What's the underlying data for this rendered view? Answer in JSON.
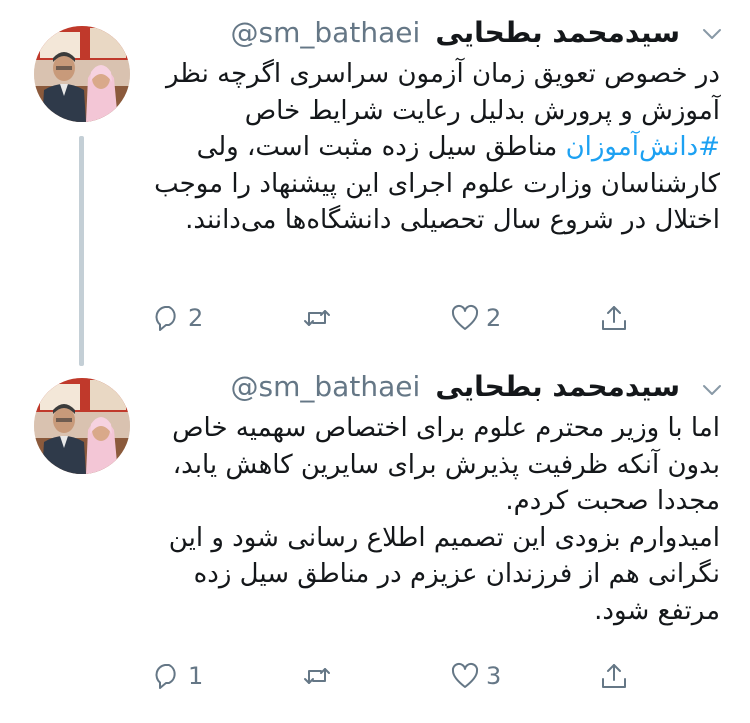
{
  "tweets": [
    {
      "author_name": "سیدمحمد بطحایی",
      "handle": "@sm_bathaei",
      "text_before_hashtag": "در خصوص تعویق زمان آزمون سراسری اگرچه نظر آموزش و پرورش بدلیل رعایت شرایط خاص ",
      "hashtag": "#دانش‌آموزان",
      "text_after_hashtag": " مناطق سیل زده مثبت است، ولی کارشناسان وزارت علوم اجرای این پیشنهاد را موجب اختلال در شروع سال تحصیلی دانشگاه‌ها می‌دانند.",
      "reply_count": "2",
      "retweet_count": "",
      "like_count": "2",
      "icons": {
        "reply": "reply-icon",
        "retweet": "retweet-icon",
        "like": "heart-icon",
        "share": "share-icon",
        "menu": "chevron-down-icon"
      }
    },
    {
      "author_name": "سیدمحمد بطحایی",
      "handle": "@sm_bathaei",
      "paragraph_1": "اما با وزیر محترم علوم برای اختصاص سهمیه خاص بدون آنکه ظرفیت پذیرش برای سایرین کاهش یابد، مجددا صحبت کردم.",
      "paragraph_2": "امیدوارم بزودی این تصمیم اطلاع رسانی شود و این نگرانی هم از فرزندان عزیزم در مناطق سیل زده مرتفع شود.",
      "reply_count": "1",
      "retweet_count": "",
      "like_count": "3",
      "icons": {
        "reply": "reply-icon",
        "retweet": "retweet-icon",
        "like": "heart-icon",
        "share": "share-icon",
        "menu": "chevron-down-icon"
      }
    }
  ],
  "colors": {
    "text": "#14171a",
    "secondary": "#657786",
    "hashtag": "#1da1f2",
    "thread_line": "#c4cfd6"
  }
}
